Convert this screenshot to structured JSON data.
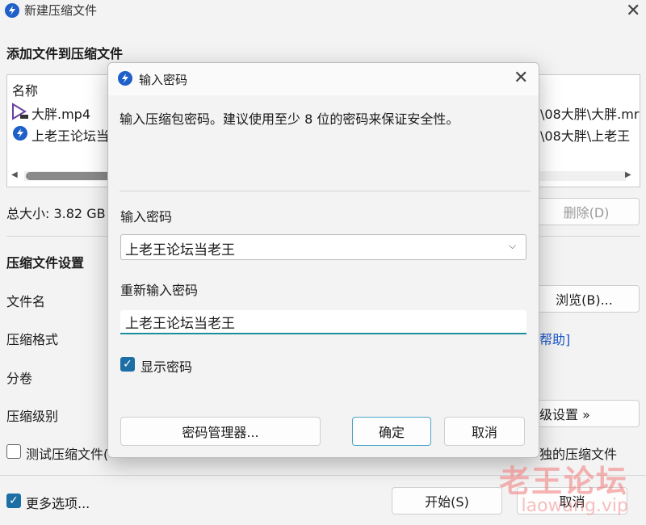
{
  "window": {
    "title": "新建压缩文件"
  },
  "main": {
    "section_add": "添加文件到压缩文件",
    "file_list": {
      "column_name": "名称",
      "files": [
        {
          "name": "大胖.mp4",
          "path": "\\08大胖\\大胖.mr",
          "icon": "video-file-icon"
        },
        {
          "name": "上老王论坛当老王",
          "path": "\\08大胖\\上老王",
          "icon": "app-file-icon"
        }
      ]
    },
    "total_size": "总大小: 3.82 GB",
    "delete_label": "删除(D)",
    "section_settings": "压缩文件设置",
    "labels": {
      "filename": "文件名",
      "format": "压缩格式",
      "split": "分卷",
      "level": "压缩级别"
    },
    "browse_label": "浏览(B)...",
    "help_link": "帮助]",
    "advanced_label": "级设置 »",
    "test_label": "测试压缩文件(",
    "separate_label": "独的压缩文件",
    "more_options_label": "更多选项...",
    "more_options_checked": true,
    "start_label": "开始(S)",
    "cancel_label": "取消"
  },
  "dialog": {
    "title": "输入密码",
    "message": "输入压缩包密码。建议使用至少 8 位的密码来保证安全性。",
    "password_label": "输入密码",
    "password_value": "上老王论坛当老王",
    "reenter_label": "重新输入密码",
    "reenter_value": "上老王论坛当老王",
    "show_password_label": "显示密码",
    "show_password_checked": true,
    "manager_label": "密码管理器...",
    "ok_label": "确定",
    "cancel_label": "取消"
  },
  "watermark": {
    "line1": "老王论坛",
    "line2": "laowang.vip"
  },
  "colors": {
    "accent": "#1c6ea4",
    "link": "#1a55c8",
    "input_focus": "#1c8d9c"
  }
}
